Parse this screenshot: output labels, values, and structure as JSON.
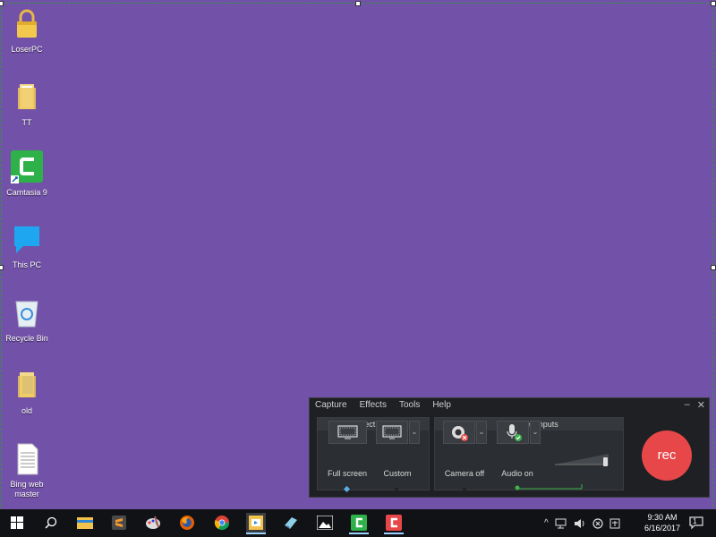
{
  "desktop": {
    "background_color": "#7251a8",
    "icons": [
      {
        "label": "LoserPC",
        "icon": "lock-icon"
      },
      {
        "label": "TT",
        "icon": "folder-icon"
      },
      {
        "label": "Camtasia 9",
        "icon": "camtasia-icon"
      },
      {
        "label": "This PC",
        "icon": "this-pc-icon"
      },
      {
        "label": "Recycle Bin",
        "icon": "recycle-bin-icon"
      },
      {
        "label": "old",
        "icon": "folder-icon"
      },
      {
        "label": "Bing web master",
        "icon": "document-icon"
      }
    ]
  },
  "recorder": {
    "menu": [
      "Capture",
      "Effects",
      "Tools",
      "Help"
    ],
    "window_controls": {
      "minimize": "–",
      "close": "✕"
    },
    "select_area": {
      "title": "Select area",
      "full_screen_label": "Full screen",
      "custom_label": "Custom"
    },
    "recorded_inputs": {
      "title": "Recorded inputs",
      "camera_label": "Camera off",
      "audio_label": "Audio on"
    },
    "rec_label": "rec",
    "accent": "#e8474a"
  },
  "taskbar": {
    "clock_time": "9:30 AM",
    "clock_date": "6/16/2017",
    "notification_count": "1",
    "items": [
      "start-icon",
      "search-icon",
      "file-explorer-icon",
      "sublime-icon",
      "paint-icon",
      "firefox-icon",
      "chrome-icon",
      "screen-recorder-icon",
      "sketch-icon",
      "photos-icon",
      "camtasia-icon",
      "camtasia-recorder-icon"
    ]
  }
}
